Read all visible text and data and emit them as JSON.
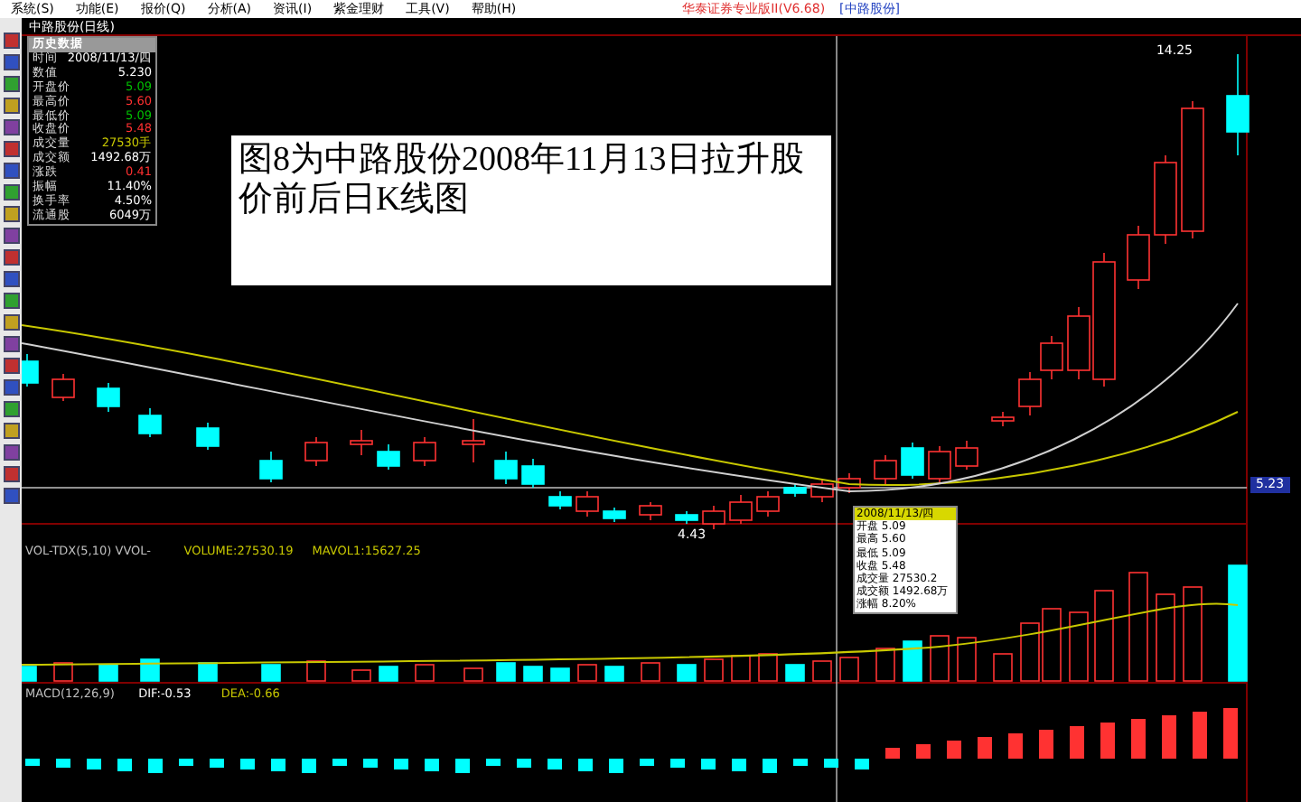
{
  "menu": [
    "系统(S)",
    "功能(E)",
    "报价(Q)",
    "分析(A)",
    "资讯(I)",
    "紫金理财",
    "工具(V)",
    "帮助(H)"
  ],
  "app_title": "华泰证券专业版II(V6.68)",
  "stock_tag": "[中路股份]",
  "chart_title": "中路股份(日线)",
  "info_panel": {
    "title": "历史数据",
    "rows": [
      {
        "label": "时间",
        "value": "2008/11/13/四",
        "color": "#ffffff"
      },
      {
        "label": "数值",
        "value": "5.230",
        "color": "#ffffff"
      },
      {
        "label": "开盘价",
        "value": "5.09",
        "color": "#00c000"
      },
      {
        "label": "最高价",
        "value": "5.60",
        "color": "#ff3030"
      },
      {
        "label": "最低价",
        "value": "5.09",
        "color": "#00c000"
      },
      {
        "label": "收盘价",
        "value": "5.48",
        "color": "#ff3030"
      },
      {
        "label": "成交量",
        "value": "27530手",
        "color": "#c8c800"
      },
      {
        "label": "成交额",
        "value": "1492.68万",
        "color": "#ffffff"
      },
      {
        "label": "涨跌",
        "value": "0.41",
        "color": "#ff3030"
      },
      {
        "label": "振幅",
        "value": "11.40%",
        "color": "#ffffff"
      },
      {
        "label": "换手率",
        "value": "4.50%",
        "color": "#ffffff"
      },
      {
        "label": "流通股",
        "value": "6049万",
        "color": "#ffffff"
      }
    ]
  },
  "annotation": "图8为中路股份2008年11月13日拉升股价前后日K线图",
  "tooltip": {
    "header": "2008/11/13/四",
    "rows": [
      "开盘 5.09",
      "最高 5.60",
      "最低 5.09",
      "收盘 5.48",
      "成交量 27530.2",
      "成交额 1492.68万",
      "涨幅 8.20%"
    ]
  },
  "price_labels": {
    "high": "14.25",
    "low": "4.43",
    "current": "5.23"
  },
  "volume_legend": [
    {
      "text": "VOL-TDX(5,10) VVOL-",
      "color": "#c0c0c0"
    },
    {
      "text": "VOLUME:27530.19",
      "color": "#c8c800"
    },
    {
      "text": "MAVOL1:15627.25",
      "color": "#c8c800"
    }
  ],
  "macd_legend": [
    {
      "text": "MACD(12,26,9)",
      "color": "#c0c0c0"
    },
    {
      "text": "DIF:-0.53",
      "color": "#ffffff"
    },
    {
      "text": "DEA:-0.66",
      "color": "#c8c800"
    }
  ]
}
